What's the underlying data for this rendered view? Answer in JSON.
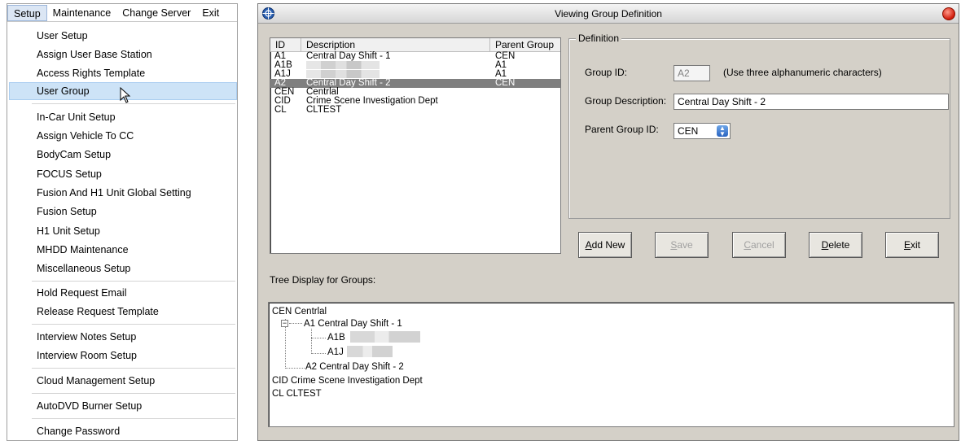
{
  "menubar": {
    "items": [
      "Setup",
      "Maintenance",
      "Change Server",
      "Exit"
    ],
    "active_index": 0
  },
  "menu": {
    "items": [
      "User Setup",
      "Assign User Base Station",
      "Access Rights Template",
      "User Group",
      "In-Car Unit Setup",
      "Assign Vehicle To CC",
      "BodyCam Setup",
      "FOCUS Setup",
      "Fusion And H1 Unit Global Setting",
      "Fusion Setup",
      "H1 Unit Setup",
      "MHDD Maintenance",
      "Miscellaneous Setup",
      "Hold Request Email",
      "Release Request Template",
      "Interview Notes Setup",
      "Interview Room Setup",
      "Cloud Management Setup",
      "AutoDVD Burner Setup",
      "Change Password"
    ],
    "selected": "User Group"
  },
  "window": {
    "title": "Viewing Group Definition"
  },
  "group_list": {
    "columns": [
      "ID",
      "Description",
      "Parent Group"
    ],
    "rows": [
      {
        "id": "A1",
        "description": "Central Day Shift - 1",
        "parent": "CEN",
        "redacted": false
      },
      {
        "id": "A1B",
        "description": "",
        "parent": "A1",
        "redacted": true
      },
      {
        "id": "A1J",
        "description": "",
        "parent": "A1",
        "redacted": true
      },
      {
        "id": "A2",
        "description": "Central Day Shift - 2",
        "parent": "CEN",
        "redacted": false,
        "selected": true
      },
      {
        "id": "CEN",
        "description": "Centrlal",
        "parent": "",
        "redacted": false
      },
      {
        "id": "CID",
        "description": "Crime Scene Investigation Dept",
        "parent": "",
        "redacted": false
      },
      {
        "id": "CL",
        "description": "CLTEST",
        "parent": "",
        "redacted": false
      }
    ]
  },
  "definition": {
    "legend": "Definition",
    "group_id_label": "Group ID:",
    "group_id_value": "A2",
    "group_id_hint": "(Use three alphanumeric characters)",
    "group_desc_label": "Group Description:",
    "group_desc_value": "Central Day Shift - 2",
    "parent_label": "Parent Group ID:",
    "parent_value": "CEN"
  },
  "buttons": {
    "add_new": "Add New",
    "save": "Save",
    "cancel": "Cancel",
    "delete": "Delete",
    "exit": "Exit"
  },
  "tree": {
    "label": "Tree Display for Groups:",
    "nodes": {
      "cen": "CEN Centrlal",
      "a1": "A1 Central Day Shift - 1",
      "a1b": "A1B",
      "a1j": "A1J",
      "a2": "A2 Central Day Shift - 2",
      "cid": "CID Crime Scene Investigation Dept",
      "cl": "CL CLTEST"
    }
  },
  "icons": {
    "app": "crosshair-icon",
    "close": "close-icon",
    "cursor": "mouse-pointer-icon",
    "spinner": "spinner-icon",
    "tree_toggle": "collapse-icon"
  }
}
